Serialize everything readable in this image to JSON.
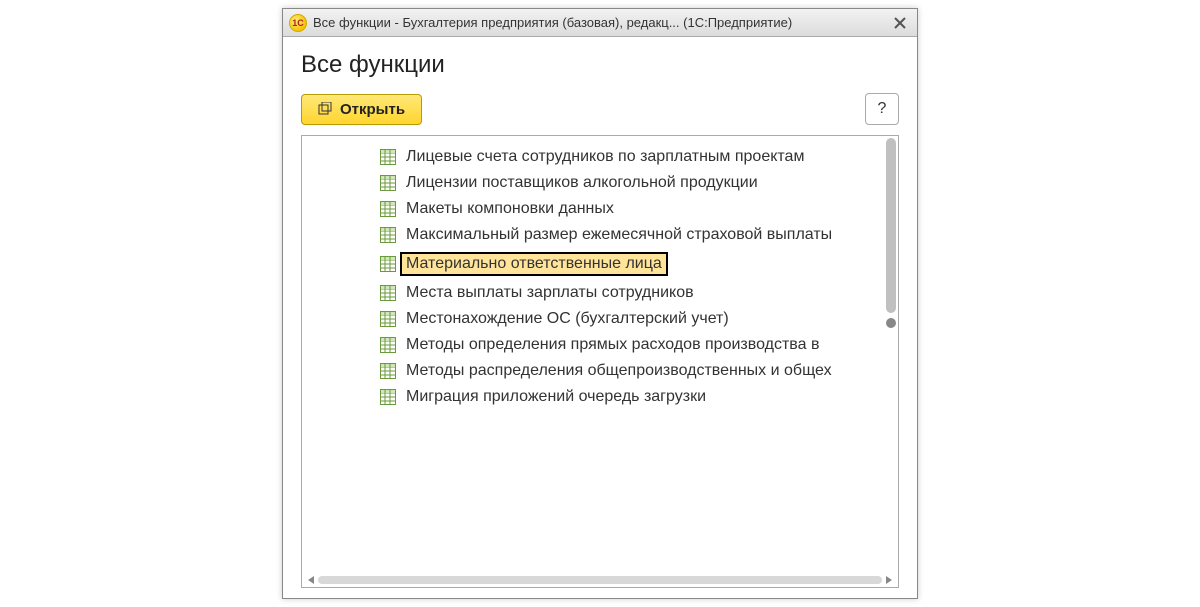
{
  "window": {
    "title": "Все функции - Бухгалтерия предприятия (базовая), редакц... (1С:Предприятие)",
    "app_icon_text": "1С"
  },
  "page": {
    "title": "Все функции"
  },
  "toolbar": {
    "open_label": "Открыть",
    "help_label": "?"
  },
  "tree": {
    "items": [
      {
        "label": "Лицевые счета сотрудников по зарплатным проектам",
        "highlighted": false
      },
      {
        "label": "Лицензии поставщиков алкогольной продукции",
        "highlighted": false
      },
      {
        "label": "Макеты компоновки данных",
        "highlighted": false
      },
      {
        "label": "Максимальный размер ежемесячной страховой выплаты",
        "highlighted": false
      },
      {
        "label": "Материально ответственные лица",
        "highlighted": true
      },
      {
        "label": "Места выплаты зарплаты сотрудников",
        "highlighted": false
      },
      {
        "label": "Местонахождение ОС (бухгалтерский учет)",
        "highlighted": false
      },
      {
        "label": "Методы определения прямых расходов производства в ",
        "highlighted": false
      },
      {
        "label": "Методы распределения общепроизводственных и общех",
        "highlighted": false
      },
      {
        "label": "Миграция приложений очередь загрузки",
        "highlighted": false
      }
    ]
  }
}
